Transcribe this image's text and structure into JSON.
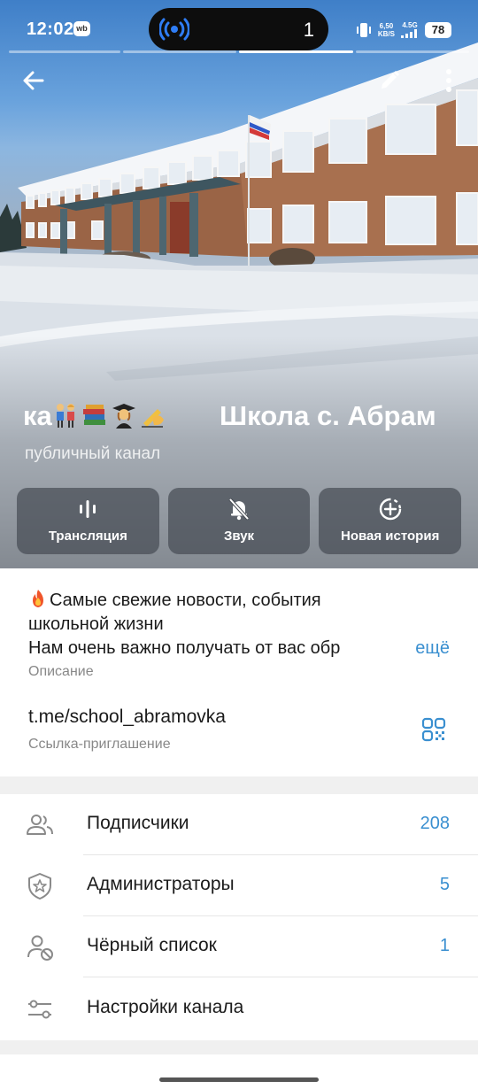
{
  "status_bar": {
    "time": "12:02",
    "app_badge": "wb",
    "island_count": "1",
    "net_speed_value": "6,50",
    "net_speed_unit": "KB/S",
    "network": "4.5G",
    "battery": "78"
  },
  "header": {
    "title_left": "ка",
    "title_right": "Школа с. Абрам",
    "subtitle": "публичный канал",
    "emojis": [
      "couple-icon",
      "books-icon",
      "graduate-icon",
      "writing-hand-icon"
    ]
  },
  "actions": [
    {
      "label": "Трансляция",
      "icon": "live-stream-icon"
    },
    {
      "label": "Звук",
      "icon": "bell-off-icon"
    },
    {
      "label": "Новая история",
      "icon": "new-story-icon"
    }
  ],
  "info": {
    "description_line1": "Самые свежие новости,  события",
    "description_line2": "школьной жизни",
    "description_line3": "Нам очень важно получать от вас  обр",
    "more_label": "ещё",
    "description_caption": "Описание",
    "invite_link": "t.me/school_abramovka",
    "invite_caption": "Ссылка-приглашение"
  },
  "list": [
    {
      "label": "Подписчики",
      "value": "208",
      "icon": "subscribers-icon"
    },
    {
      "label": "Администраторы",
      "value": "5",
      "icon": "admin-shield-icon"
    },
    {
      "label": "Чёрный список",
      "value": "1",
      "icon": "blocked-user-icon"
    },
    {
      "label": "Настройки канала",
      "value": "",
      "icon": "settings-sliders-icon"
    }
  ],
  "colors": {
    "accent": "#3a8fd0",
    "text": "#1b1b1b",
    "caption": "#888888",
    "background": "#f0f0f0"
  }
}
